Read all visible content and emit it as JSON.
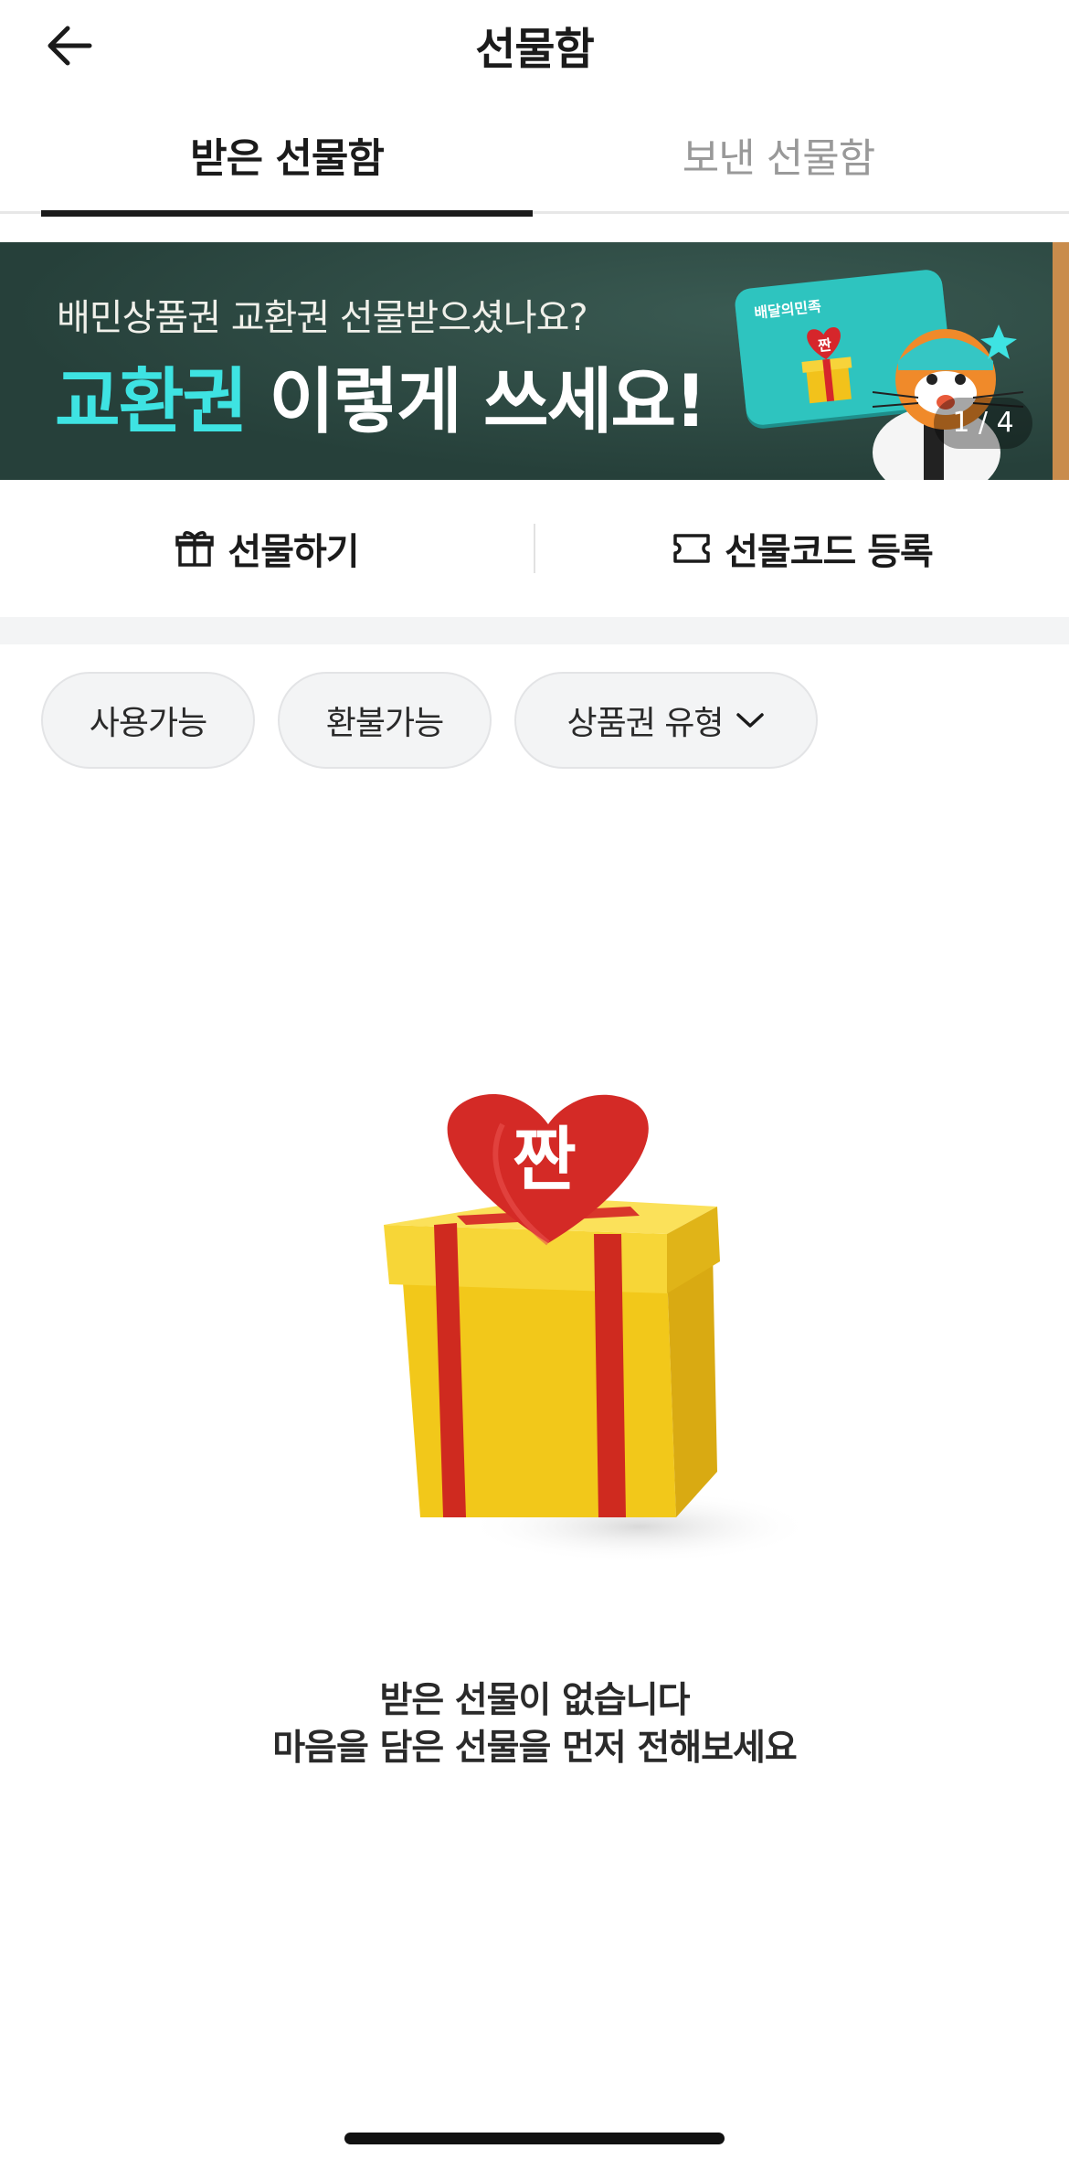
{
  "header": {
    "title": "선물함",
    "back_icon": "arrow-left-icon"
  },
  "tabs": [
    {
      "label": "받은 선물함",
      "active": true
    },
    {
      "label": "보낸 선물함",
      "active": false
    }
  ],
  "banner": {
    "subtitle": "배민상품권 교환권 선물받으셨나요?",
    "title_accent": "교환권",
    "title_rest": " 이렇게 쓰세요!",
    "card_label": "배달의민족",
    "heart_text": "짠",
    "counter": "1 / 4",
    "accent_color": "#3ee3e2"
  },
  "actions": {
    "gift": {
      "label": "선물하기",
      "icon": "gift-icon"
    },
    "code": {
      "label": "선물코드 등록",
      "icon": "ticket-icon"
    }
  },
  "filters": [
    {
      "label": "사용가능"
    },
    {
      "label": "환불가능"
    },
    {
      "label": "상품권 유형",
      "icon": "chevron-down-icon"
    }
  ],
  "empty_state": {
    "heart_text": "짠",
    "line1": "받은 선물이 없습니다",
    "line2": "마음을 담은 선물을 먼저 전해보세요"
  }
}
